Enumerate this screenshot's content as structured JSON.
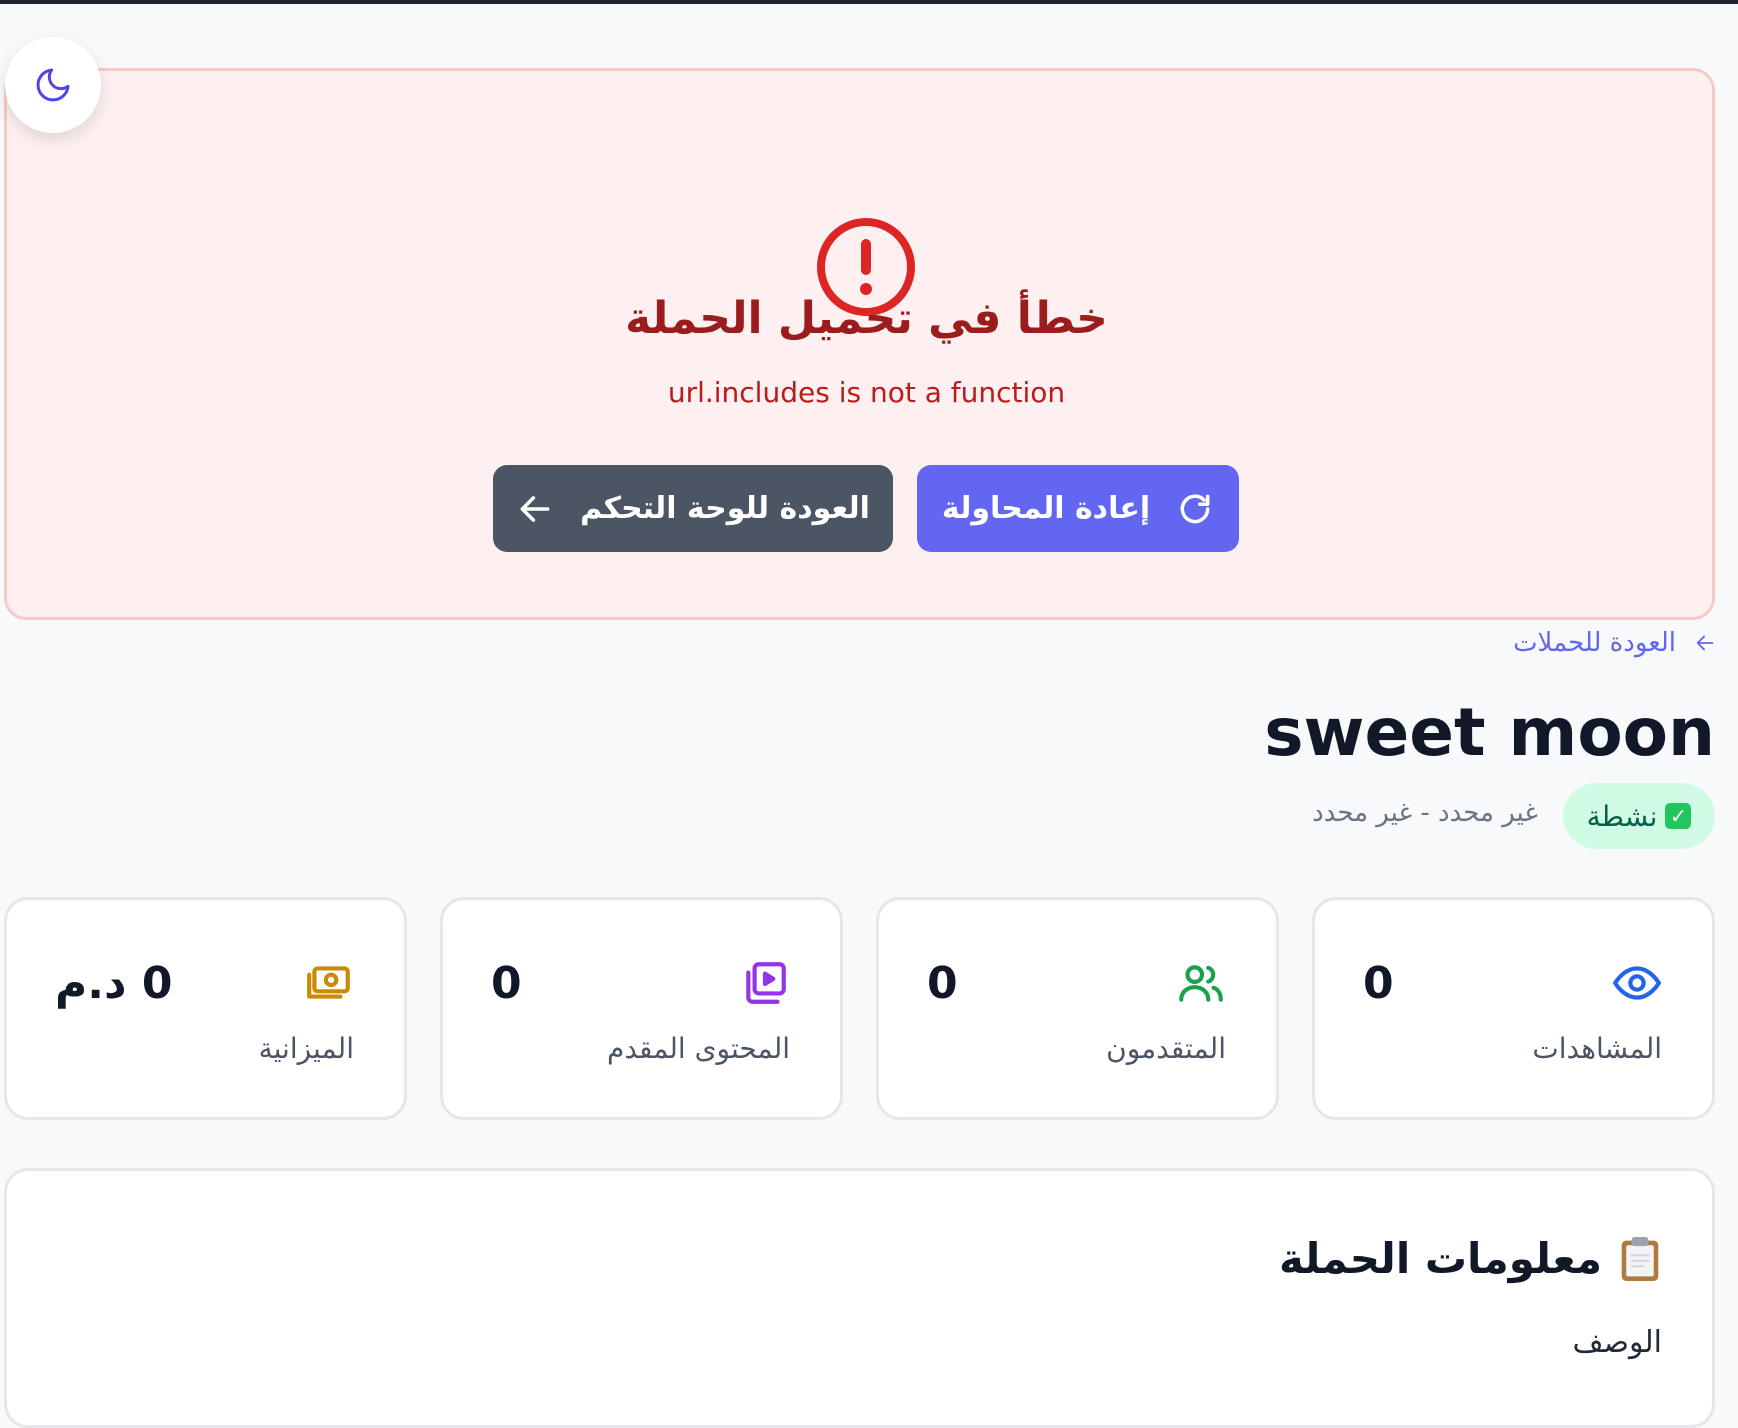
{
  "theme_toggle": {
    "icon": "moon-icon"
  },
  "error": {
    "icon": "alert-circle-icon",
    "title": "خطأ في تحميل الحملة",
    "message": "url.includes is not a function",
    "retry_label": "إعادة المحاولة",
    "back_label": "العودة للوحة التحكم"
  },
  "back_link": {
    "label": "العودة للحملات"
  },
  "campaign": {
    "title": "sweet moon",
    "status": "نشطة",
    "date_range": "غير محدد - غير محدد"
  },
  "stats": [
    {
      "label": "المشاهدات",
      "value": "0",
      "icon": "eye-icon",
      "color": "#2563eb"
    },
    {
      "label": "المتقدمون",
      "value": "0",
      "icon": "users-icon",
      "color": "#16a34a"
    },
    {
      "label": "المحتوى المقدم",
      "value": "0",
      "icon": "video-library-icon",
      "color": "#9333ea"
    },
    {
      "label": "الميزانية",
      "value": "0 د.م",
      "icon": "money-icon",
      "color": "#ca8a04"
    }
  ],
  "info": {
    "title": "معلومات الحملة",
    "description_label": "الوصف"
  },
  "colors": {
    "accent": "#6366f1",
    "error": "#b91c1c",
    "success_bg": "#d1fae5"
  }
}
